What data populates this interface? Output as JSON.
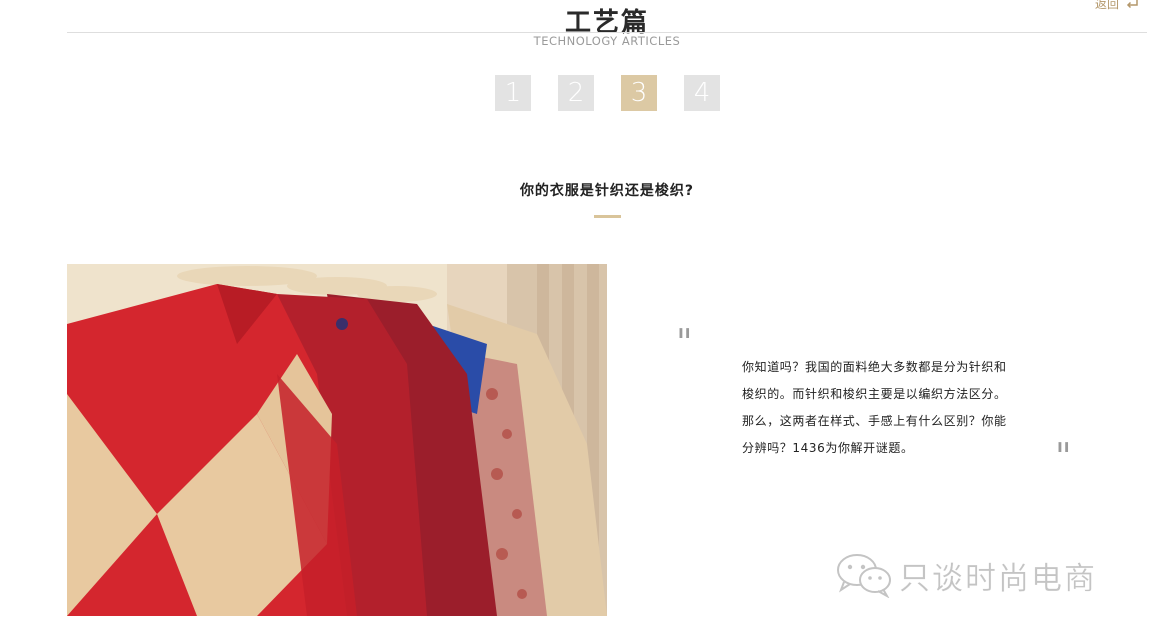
{
  "header": {
    "title": "工艺篇",
    "subtitle": "TECHNOLOGY ARTICLES",
    "back_label": "返回"
  },
  "pager": {
    "pages": [
      "1",
      "2",
      "3",
      "4"
    ],
    "active": "3"
  },
  "article": {
    "title": "你的衣服是针织还是梭织?",
    "quote_open": "\"",
    "quote_close": "\"",
    "body": "你知道吗？我国的面料绝大多数都是分为针织和梭织的。而针织和梭织主要是以编织方法区分。那么，这两者在样式、手感上有什么区别？你能分辨吗？1436为你解开谜题。"
  },
  "watermark": {
    "text": "只谈时尚电商"
  },
  "colors": {
    "accent_gold": "#dcc9a4",
    "page_inactive": "#e3e3e3",
    "back_link": "#b3976a"
  },
  "icons": {
    "back": "return-arrow-icon",
    "watermark": "wechat-icon"
  }
}
